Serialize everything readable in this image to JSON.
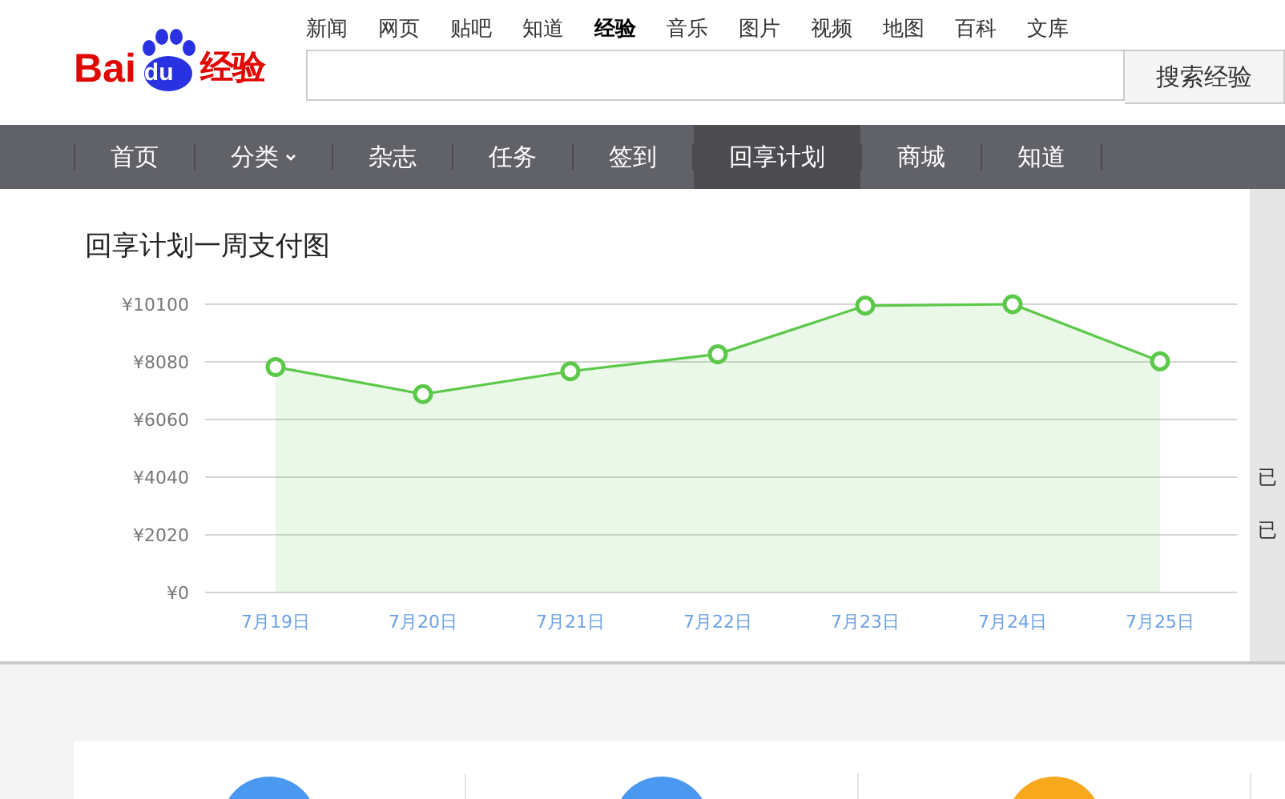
{
  "logo": {
    "part_1": "Bai",
    "part_2": "du",
    "part_3": "经验"
  },
  "top_links": [
    {
      "label": "新闻",
      "selected": false
    },
    {
      "label": "网页",
      "selected": false
    },
    {
      "label": "贴吧",
      "selected": false
    },
    {
      "label": "知道",
      "selected": false
    },
    {
      "label": "经验",
      "selected": true
    },
    {
      "label": "音乐",
      "selected": false
    },
    {
      "label": "图片",
      "selected": false
    },
    {
      "label": "视频",
      "selected": false
    },
    {
      "label": "地图",
      "selected": false
    },
    {
      "label": "百科",
      "selected": false
    },
    {
      "label": "文库",
      "selected": false
    }
  ],
  "search": {
    "button": "搜索经验"
  },
  "nav": [
    {
      "label": "首页",
      "selected": false,
      "dropdown": false
    },
    {
      "label": "分类",
      "selected": false,
      "dropdown": true
    },
    {
      "label": "杂志",
      "selected": false,
      "dropdown": false
    },
    {
      "label": "任务",
      "selected": false,
      "dropdown": false
    },
    {
      "label": "签到",
      "selected": false,
      "dropdown": false
    },
    {
      "label": "回享计划",
      "selected": true,
      "dropdown": false
    },
    {
      "label": "商城",
      "selected": false,
      "dropdown": false
    },
    {
      "label": "知道",
      "selected": false,
      "dropdown": false
    }
  ],
  "chart_panel": {
    "title": "回享计划一周支付图",
    "chart_data": {
      "type": "area",
      "categories": [
        "7月19日",
        "7月20日",
        "7月21日",
        "7月22日",
        "7月23日",
        "7月24日",
        "7月25日"
      ],
      "grid": true,
      "series": [
        {
          "color": "#5cc84a",
          "values": [
            7900,
            6950,
            7750,
            8350,
            10050,
            10100,
            8100
          ]
        }
      ],
      "ylim": [
        0,
        10100
      ],
      "yticks": [
        {
          "value": 0,
          "label": "¥0"
        },
        {
          "value": 2020,
          "label": "¥2020"
        },
        {
          "value": 4040,
          "label": "¥4040"
        },
        {
          "value": 6060,
          "label": "¥6060"
        },
        {
          "value": 8080,
          "label": "¥8080"
        },
        {
          "value": 10100,
          "label": "¥10100"
        }
      ]
    }
  },
  "side_panel": {
    "lines": [
      "已",
      "已"
    ]
  },
  "feature_icons": [
    {
      "color": "#4a98f0"
    },
    {
      "color": "#4a98f0"
    },
    {
      "color": "#f8a81c"
    }
  ]
}
